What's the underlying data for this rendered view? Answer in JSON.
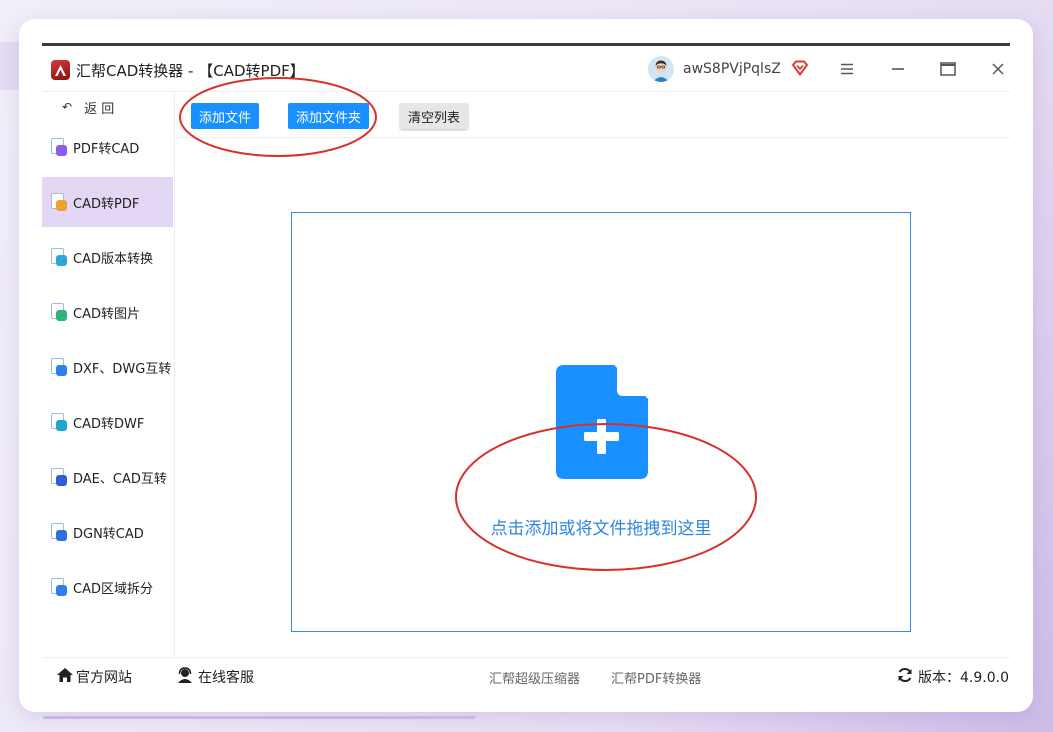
{
  "window": {
    "title": "汇帮CAD转换器 - 【CAD转PDF】",
    "username": "awS8PVjPqlsZ"
  },
  "sidebar": {
    "back_label": "返 回",
    "items": [
      {
        "label": "PDF转CAD",
        "icon": "pdf-to-cad-icon",
        "color": "#8a5cf0"
      },
      {
        "label": "CAD转PDF",
        "icon": "cad-to-pdf-icon",
        "color": "#f0a030",
        "active": true
      },
      {
        "label": "CAD版本转换",
        "icon": "cad-version-icon",
        "color": "#2aa8d8"
      },
      {
        "label": "CAD转图片",
        "icon": "cad-to-image-icon",
        "color": "#2cb67d"
      },
      {
        "label": "DXF、DWG互转",
        "icon": "dxf-dwg-icon",
        "color": "#2f80ed"
      },
      {
        "label": "CAD转DWF",
        "icon": "cad-to-dwf-icon",
        "color": "#1fa5c9"
      },
      {
        "label": "DAE、CAD互转",
        "icon": "dae-cad-icon",
        "color": "#2f5bd8"
      },
      {
        "label": "DGN转CAD",
        "icon": "dgn-to-cad-icon",
        "color": "#2f6fdb"
      },
      {
        "label": "CAD区域拆分",
        "icon": "cad-split-icon",
        "color": "#2f80ed"
      }
    ]
  },
  "toolbar": {
    "add_file": "添加文件",
    "add_folder": "添加文件夹",
    "clear_list": "清空列表"
  },
  "dropzone": {
    "text": "点击添加或将文件拖拽到这里",
    "icon": "file-add-icon",
    "color": "#1890ff"
  },
  "footer": {
    "website": "官方网站",
    "support": "在线客服",
    "link1": "汇帮超级压缩器",
    "link2": "汇帮PDF转换器",
    "version": "版本：4.9.0.0"
  },
  "colors": {
    "accent": "#1890ff",
    "active_nav": "#e3d7f5",
    "annotation": "#d9302b"
  }
}
